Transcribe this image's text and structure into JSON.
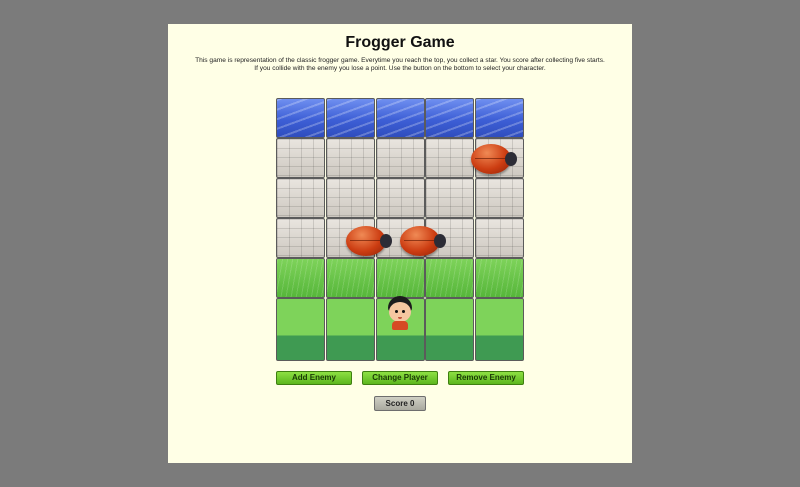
{
  "title": "Frogger Game",
  "description_line1": "This game is representation of the classic frogger game. Everytime you reach the top, you collect a star. You score after collecting five starts.",
  "description_line2": "If you collide with the enemy you lose a point. Use the button on the bottom to select your character.",
  "board": {
    "cols": 5,
    "rows": [
      "water",
      "stone",
      "stone",
      "stone",
      "grass",
      "grass-bottom"
    ]
  },
  "buttons": {
    "add_enemy": "Add Enemy",
    "change_player": "Change Player",
    "remove_enemy": "Remove Enemy"
  },
  "score": {
    "label": "Score",
    "value": 0,
    "text": "Score 0"
  },
  "colors": {
    "background": "#7b7b7b",
    "panel": "#ffffe6",
    "button": "#6cc629",
    "score_button": "#bdbdb2"
  }
}
